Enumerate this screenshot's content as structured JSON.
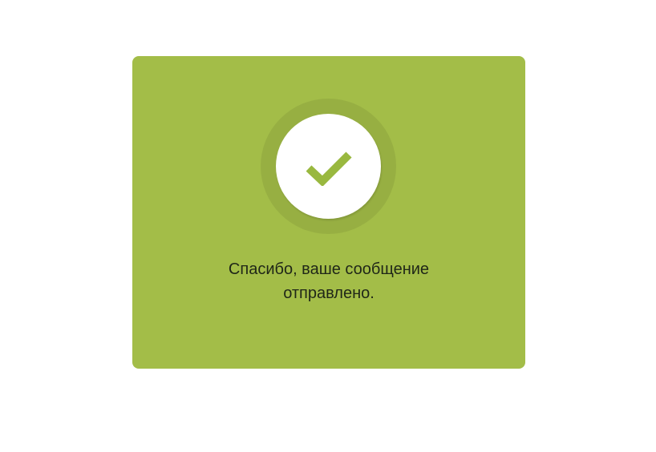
{
  "colors": {
    "card_background": "#a3bd48",
    "checkmark": "#99b83f"
  },
  "icon": "checkmark-icon",
  "message": "Спасибо, ваше сообщение отправлено."
}
